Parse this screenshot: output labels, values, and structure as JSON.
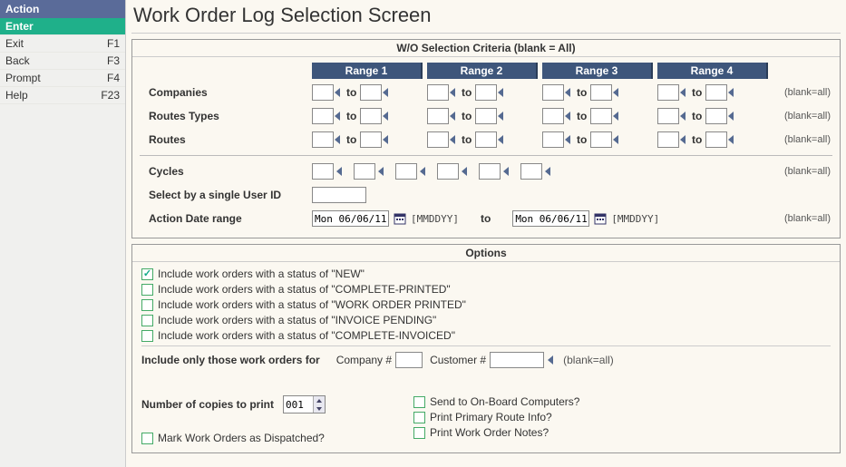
{
  "sidebar": {
    "header": "Action",
    "items": [
      {
        "label": "Enter",
        "key": "",
        "active": true
      },
      {
        "label": "Exit",
        "key": "F1",
        "active": false
      },
      {
        "label": "Back",
        "key": "F3",
        "active": false
      },
      {
        "label": "Prompt",
        "key": "F4",
        "active": false
      },
      {
        "label": "Help",
        "key": "F23",
        "active": false
      }
    ]
  },
  "page": {
    "title": "Work Order Log Selection Screen"
  },
  "criteria": {
    "panel_title": "W/O Selection Criteria (blank = All)",
    "range_headers": [
      "Range 1",
      "Range 2",
      "Range 3",
      "Range 4"
    ],
    "rows": {
      "companies": {
        "label": "Companies",
        "to": "to",
        "blank": "(blank=all)"
      },
      "route_types": {
        "label": "Routes Types",
        "to": "to",
        "blank": "(blank=all)"
      },
      "routes": {
        "label": "Routes",
        "to": "to",
        "blank": "(blank=all)"
      }
    },
    "cycles": {
      "label": "Cycles",
      "blank": "(blank=all)"
    },
    "user": {
      "label": "Select by a single User ID"
    },
    "dates": {
      "label": "Action Date range",
      "from": "Mon 06/06/11",
      "to_label": "to",
      "to": "Mon 06/06/11",
      "fmt": "[MMDDYY]",
      "blank": "(blank=all)"
    }
  },
  "options": {
    "panel_title": "Options",
    "statuses": [
      {
        "label": "Include work orders with a status of \"NEW\"",
        "checked": true
      },
      {
        "label": "Include work orders with a status of \"COMPLETE-PRINTED\"",
        "checked": false
      },
      {
        "label": "Include work orders with a status of \"WORK ORDER PRINTED\"",
        "checked": false
      },
      {
        "label": "Include work orders with a status of \"INVOICE PENDING\"",
        "checked": false
      },
      {
        "label": "Include work orders with a status of \"COMPLETE-INVOICED\"",
        "checked": false
      }
    ],
    "filter": {
      "prefix": "Include only those work orders for",
      "company_label": "Company #",
      "customer_label": "Customer #",
      "blank": "(blank=all)"
    },
    "copies": {
      "label": "Number of copies to print",
      "value": "001"
    },
    "flags": {
      "dispatched": "Mark Work Orders as Dispatched?",
      "onboard": "Send to On-Board Computers?",
      "primary_route": "Print Primary Route Info?",
      "notes": "Print Work Order Notes?"
    }
  }
}
